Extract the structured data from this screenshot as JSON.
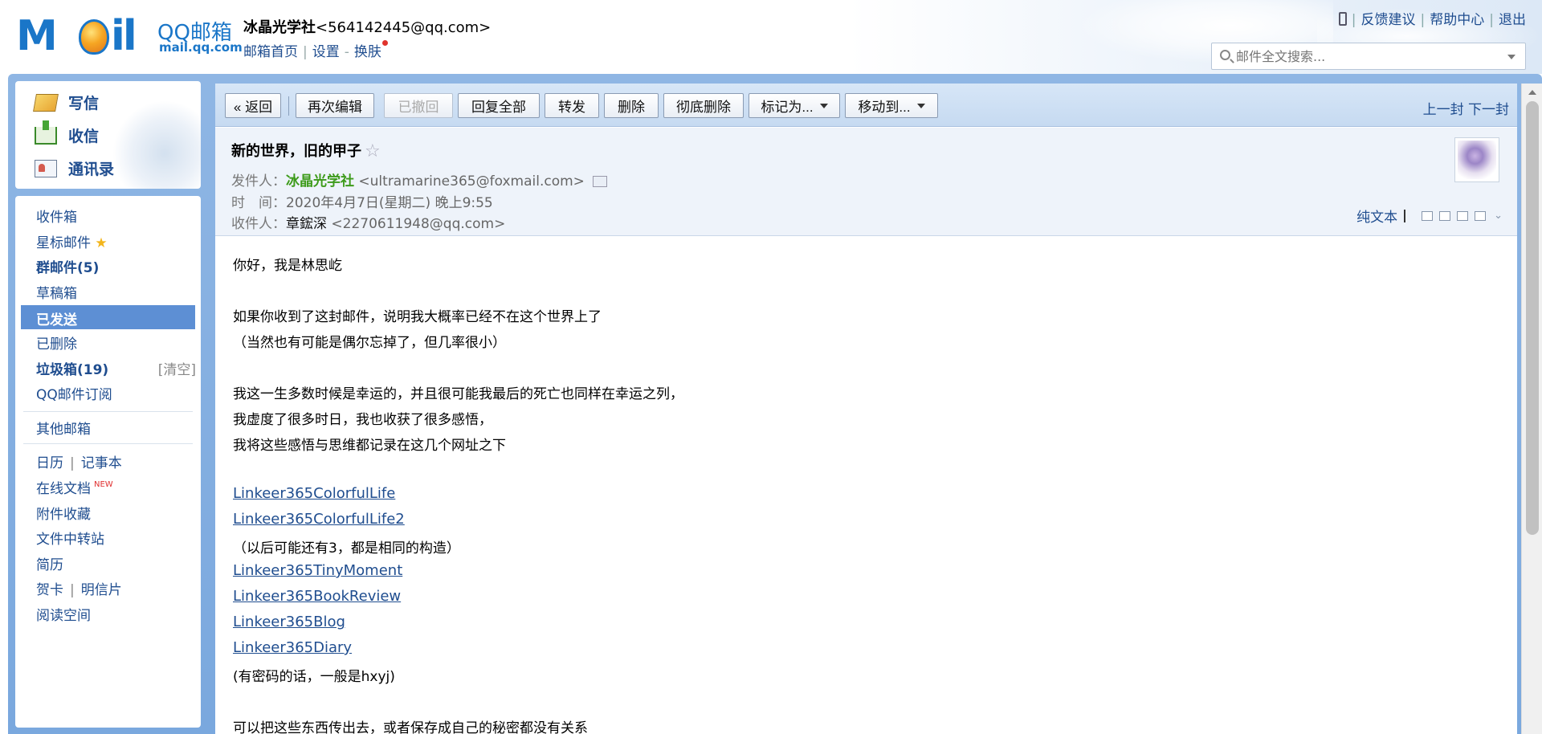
{
  "header": {
    "brand": "QQ邮箱",
    "domain": "mail.qq.com",
    "account_name": "冰晶光学社",
    "account_email": "<564142445@qq.com>",
    "links": {
      "home": "邮箱首页",
      "settings": "设置",
      "dash": "-",
      "skin": "换肤"
    },
    "top_links": {
      "feedback": "反馈建议",
      "help": "帮助中心",
      "logout": "退出"
    },
    "search_placeholder": "邮件全文搜索..."
  },
  "sidebar": {
    "compose": "写信",
    "receive": "收信",
    "contacts": "通讯录",
    "folders": {
      "inbox": "收件箱",
      "starred": "星标邮件",
      "group": "群邮件(5)",
      "drafts": "草稿箱",
      "sent": "已发送",
      "deleted": "已删除",
      "spam": "垃圾箱(19)",
      "spam_clear": "[清空]",
      "subscription": "QQ邮件订阅",
      "other": "其他邮箱",
      "calendar": "日历",
      "notes": "记事本",
      "docs": "在线文档",
      "docs_badge": "NEW",
      "attachments": "附件收藏",
      "transfer": "文件中转站",
      "resume": "简历",
      "greeting": "贺卡",
      "postcard": "明信片",
      "reading": "阅读空间"
    }
  },
  "toolbar": {
    "back": "« 返回",
    "reedit": "再次编辑",
    "recall": "已撤回",
    "reply_all": "回复全部",
    "forward": "转发",
    "delete": "删除",
    "delete_forever": "彻底删除",
    "mark_as": "标记为...",
    "move_to": "移动到...",
    "prev": "上一封",
    "next": "下一封"
  },
  "mail": {
    "subject": "新的世界，旧的甲子",
    "from_label": "发件人：",
    "from_name": "冰晶光学社",
    "from_email": "<ultramarine365@foxmail.com>",
    "time_label": "时　间：",
    "time": "2020年4月7日(星期二) 晚上9:55",
    "to_label": "收件人：",
    "to_name": "章鋐深",
    "to_email": "<2270611948@qq.com>",
    "plain_text": "纯文本"
  },
  "body": {
    "l1": "你好，我是林思屹",
    "l2": "如果你收到了这封邮件，说明我大概率已经不在这个世界上了",
    "l3": "（当然也有可能是偶尔忘掉了，但几率很小）",
    "l4": "我这一生多数时候是幸运的，并且很可能我最后的死亡也同样在幸运之列，",
    "l5": "我虚度了很多时日，我也收获了很多感悟，",
    "l6": "我将这些感悟与思维都记录在这几个网址之下",
    "link1": "Linkeer365ColorfulLife",
    "link2": "Linkeer365ColorfulLife2",
    "l7": "（以后可能还有3，都是相同的构造）",
    "link3": "Linkeer365TinyMoment",
    "link4": "Linkeer365BookReview",
    "link5": "Linkeer365Blog",
    "link6": "Linkeer365Diary",
    "l8": "(有密码的话，一般是hxyj)",
    "l9": "可以把这些东西传出去，或者保存成自己的秘密都没有关系"
  }
}
